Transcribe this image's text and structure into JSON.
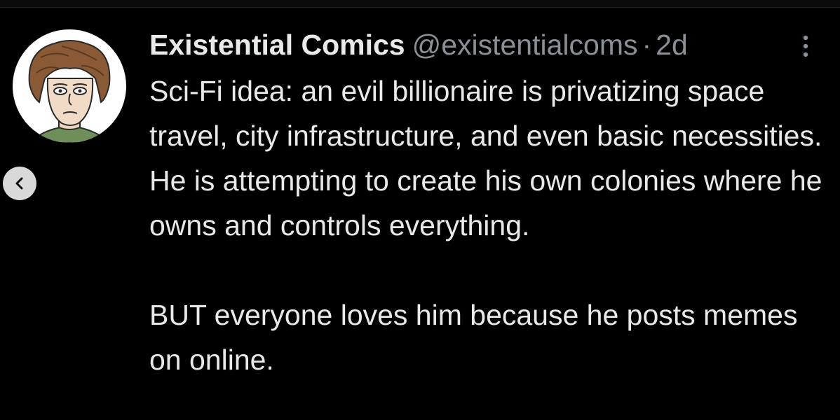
{
  "tweet": {
    "display_name": "Existential Comics",
    "handle": "@existentialcoms",
    "separator": "·",
    "time": "2d",
    "paragraphs": [
      "Sci-Fi idea: an evil billionaire is privatizing space travel, city infrastructure, and even basic necessities. He is attempting to create his own colonies where he owns and controls everything.",
      "BUT everyone loves him because he posts memes on online."
    ]
  },
  "icons": {
    "avatar": "avatar-cartoon-portrait",
    "back": "chevron-left-icon",
    "more": "more-vertical-icon"
  },
  "colors": {
    "background": "#000000",
    "text_primary": "#e7e9ea",
    "text_secondary": "#8b9096",
    "back_button": "#d9d9d9"
  }
}
